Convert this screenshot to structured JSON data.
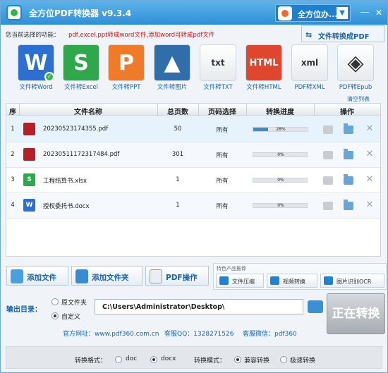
{
  "window": {
    "title": "全方位PDF转换器 v9.3.4",
    "combo_text": "全方位办...",
    "min": "—",
    "close": "✕"
  },
  "hint": {
    "label": "您当前选择的功能：",
    "red": "pdf,excel,ppt转成word文件,添加word可转成pdf文件"
  },
  "doc_to_pdf": {
    "label": "文件转换成PDF",
    "icon": "⇆"
  },
  "functions": [
    {
      "label": "文件转Word",
      "glyph": "W",
      "color": "#2b6fd1"
    },
    {
      "label": "文件转Excel",
      "glyph": "S",
      "color": "#2ea84b"
    },
    {
      "label": "文件转PPT",
      "glyph": "P",
      "color": "#ef7b28"
    },
    {
      "label": "文件转图片",
      "glyph": "▲",
      "color": "#2f6eaa"
    },
    {
      "label": "文件转TXT",
      "glyph": "txt",
      "color": "#ffffff"
    },
    {
      "label": "文件转HTML",
      "glyph": "HTML",
      "color": "#e0452d"
    },
    {
      "label": "PDF转XML",
      "glyph": "xml",
      "color": "#ffffff"
    },
    {
      "label": "PDF转Epub",
      "glyph": "◈",
      "color": "#ffffff"
    }
  ],
  "clear_list": "清空列表",
  "table": {
    "headers": [
      "序",
      "文件名称",
      "总页数",
      "页码选择",
      "转换进度",
      "操作"
    ],
    "rows": [
      {
        "idx": "1",
        "name": "20230523174355.pdf",
        "pages": "50",
        "range": "所有",
        "progress": 0.28,
        "progress_text": "28%",
        "type": "pdf",
        "color": "#b52028"
      },
      {
        "idx": "2",
        "name": "20230511172317484.pdf",
        "pages": "301",
        "range": "所有",
        "progress": 0,
        "progress_text": "0%",
        "type": "pdf",
        "color": "#b52028"
      },
      {
        "idx": "3",
        "name": "工程结算书.xlsx",
        "pages": "1",
        "range": "所有",
        "progress": 0,
        "progress_text": "0%",
        "type": "xlsx",
        "color": "#2ea84b"
      },
      {
        "idx": "4",
        "name": "授权委托书.docx",
        "pages": "1",
        "range": "所有",
        "progress": 0,
        "progress_text": "0%",
        "type": "docx",
        "color": "#2b6fd1"
      }
    ]
  },
  "buttons": {
    "add_file": "添加文件",
    "add_folder": "添加文件夹",
    "pdf_ops": "PDF操作"
  },
  "features": {
    "title": "特色产品推荐",
    "items": [
      "文件压缩",
      "视频转换",
      "图片识别OCR"
    ]
  },
  "output": {
    "label": "输出目录：",
    "opt_original": "原文件夹",
    "opt_custom": "自定义",
    "path": "C:\\Users\\Administrator\\Desktop\\",
    "start": "正在转换"
  },
  "site": {
    "web": "官方网址：www.pdf360.com.cn",
    "qq": "客服QQ：1328271526",
    "wechat": "客服微信：pdf360"
  },
  "bottom": {
    "fmt_label": "转换格式：",
    "fmt_doc": "doc",
    "fmt_docx": "docx",
    "mode_label": "转换模式：",
    "mode_compat": "兼容转换",
    "mode_fast": "极速转换"
  }
}
